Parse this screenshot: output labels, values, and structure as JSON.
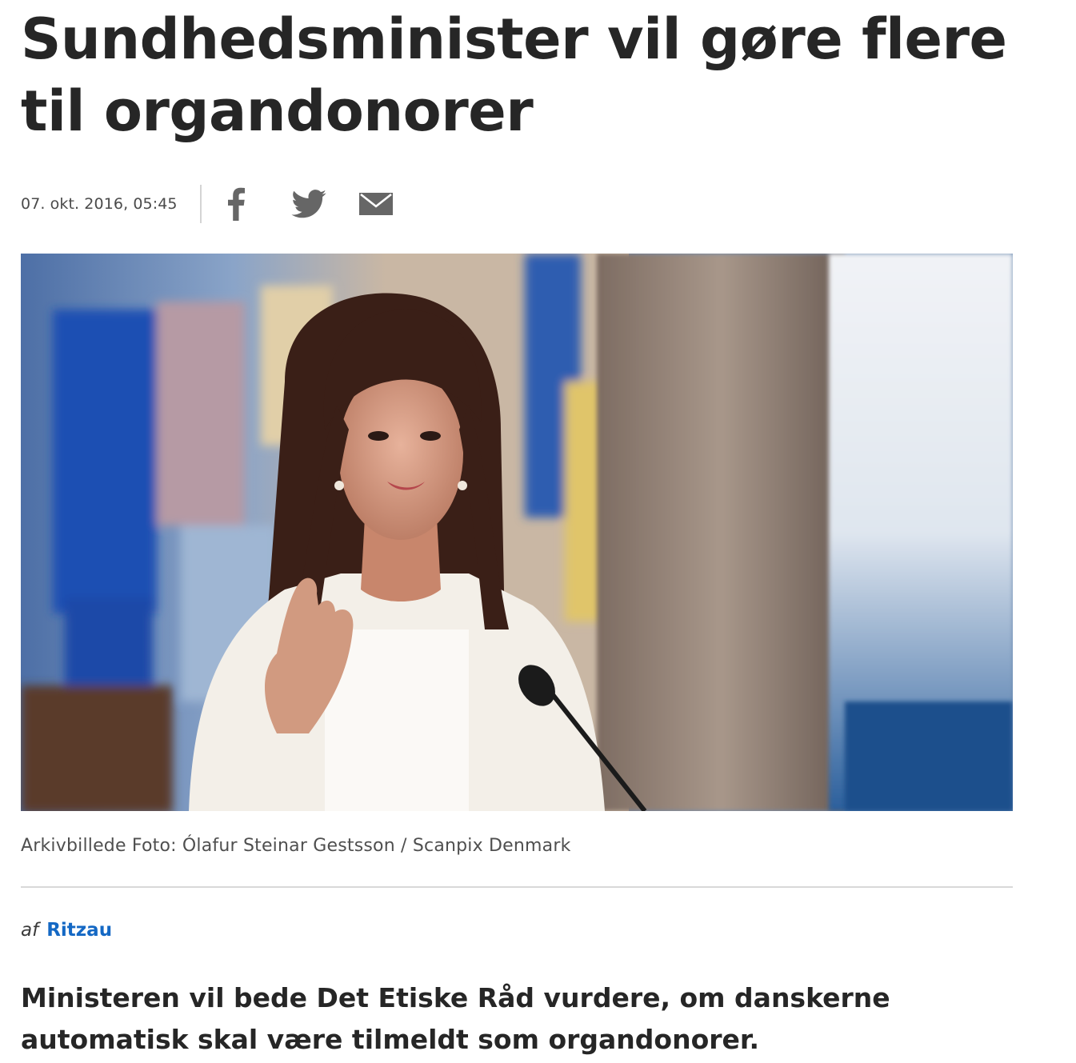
{
  "article": {
    "headline": "Sundhedsminister vil gøre flere til organdonorer",
    "timestamp": "07. okt. 2016, 05:45",
    "share": {
      "facebook_icon": "facebook-icon",
      "twitter_icon": "twitter-icon",
      "email_icon": "mail-icon"
    },
    "image_caption": "Arkivbillede Foto: Ólafur Steinar Gestsson / Scanpix Denmark",
    "byline_prefix": "af",
    "byline_author": "Ritzau",
    "lead": "Ministeren vil bede Det Etiske Råd vurdere, om danskerne automatisk skal være tilmeldt som organdonorer."
  },
  "colors": {
    "text": "#262626",
    "link": "#1468c4",
    "icon": "#666666",
    "divider": "#d8d8d8"
  }
}
